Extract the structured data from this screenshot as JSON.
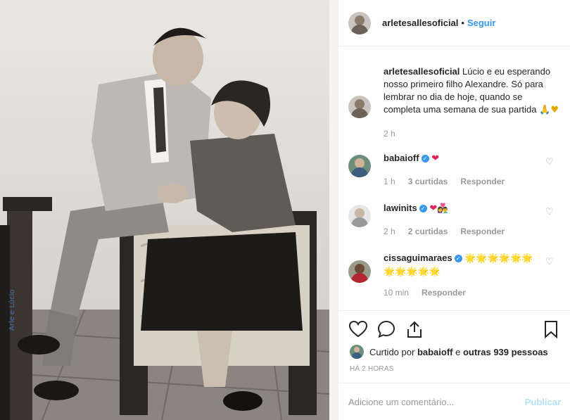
{
  "post": {
    "author": "arletesallesoficial",
    "follow_label": "Seguir",
    "dot": "•"
  },
  "caption": {
    "author": "arletesallesoficial",
    "text": "Lúcio e eu esperando nosso primeiro filho Alexandre. Só para lembrar no dia de hoje, quando se completa uma semana de sua partida",
    "emoji": "🙏♥",
    "time": "2 h"
  },
  "comments": [
    {
      "user": "babaioff",
      "verified": true,
      "text": "",
      "emoji": "❤",
      "time": "1 h",
      "likes": "3 curtidas",
      "reply": "Responder"
    },
    {
      "user": "lawinits",
      "verified": true,
      "text": "",
      "emoji": "❤👩‍❤️‍👨",
      "time": "2 h",
      "likes": "2 curtidas",
      "reply": "Responder"
    },
    {
      "user": "cissaguimaraes",
      "verified": true,
      "text": "",
      "emoji": "🌟🌟🌟🌟🌟🌟🌟🌟🌟🌟🌟",
      "time": "10 min",
      "likes": "",
      "reply": "Responder"
    }
  ],
  "likes": {
    "prefix": "Curtido por",
    "user": "babaioff",
    "middle": "e",
    "others": "outras 939 pessoas"
  },
  "time_ago": "HÁ 2 HORAS",
  "add_comment": {
    "placeholder": "Adicione um comentário...",
    "publish_label": "Publicar"
  },
  "colors": {
    "link": "#3897f0",
    "publish_disabled": "#b2dffc",
    "muted": "#999999",
    "text": "#262626"
  },
  "icons": [
    "heart-icon",
    "comment-icon",
    "share-icon",
    "bookmark-icon",
    "verified-icon"
  ]
}
